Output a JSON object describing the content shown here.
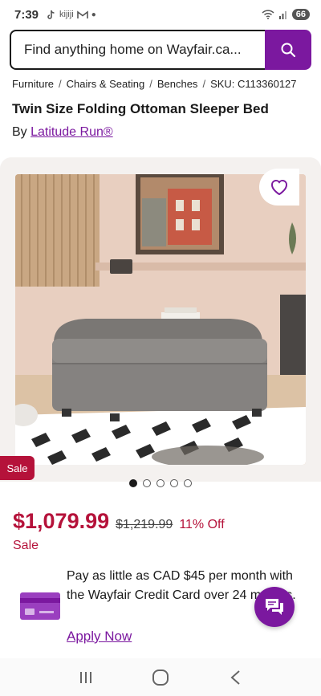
{
  "status_bar": {
    "time": "7:39",
    "app_icons": [
      "tiktok-icon",
      "kijiji-icon",
      "gmail-icon",
      "more-dot-icon"
    ],
    "app_labels": {
      "kijiji": "kijiji"
    },
    "battery": "66"
  },
  "search": {
    "placeholder": "Find anything home on Wayfair.ca...",
    "button_icon": "search-icon"
  },
  "breadcrumb": {
    "items": [
      "Furniture",
      "Chairs & Seating",
      "Benches"
    ],
    "sku": "SKU: C113360127"
  },
  "product": {
    "title": "Twin Size Folding Ottoman Sleeper Bed",
    "by_prefix": "By",
    "brand": "Latitude Run®"
  },
  "gallery": {
    "sale_badge": "Sale",
    "total_images": 5,
    "active_index": 0
  },
  "pricing": {
    "price": "$1,079.99",
    "old_price": "$1,219.99",
    "discount": "11% Off",
    "sale_label": "Sale"
  },
  "financing": {
    "text": "Pay as little as CAD $45 per month with the Wayfair Credit Card over 24 months.",
    "apply_link": "Apply Now"
  },
  "colors": {
    "brand_purple": "#7b189f",
    "sale_red": "#b5123a"
  },
  "nav": {
    "icons": [
      "recent-apps-icon",
      "home-icon",
      "back-icon"
    ]
  }
}
